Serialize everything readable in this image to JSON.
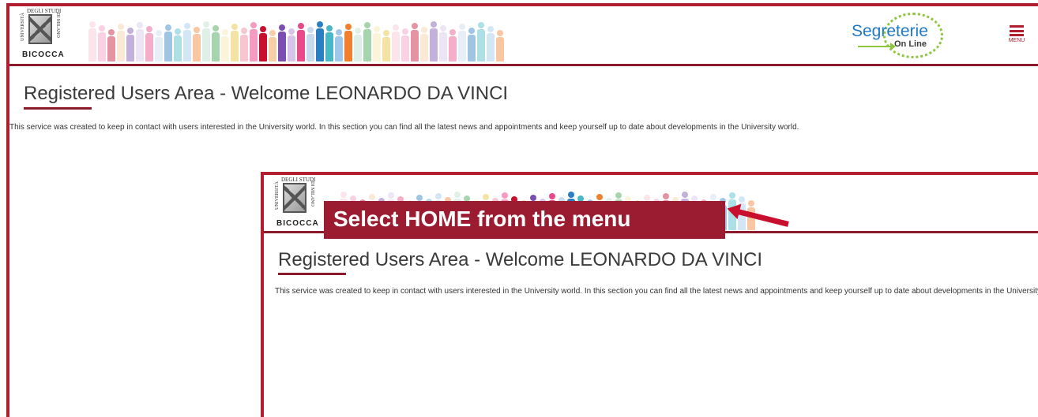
{
  "logo": {
    "top_text": "DEGLI STUDI",
    "left_text": "UNIVERSITÀ",
    "right_text": "DI MILANO",
    "bottom_text": "BICOCCA"
  },
  "header": {
    "service_logo_main": "Segreterie",
    "service_logo_sub": "On Line",
    "menu_label": "MENU"
  },
  "page": {
    "title": "Registered Users Area - Welcome LEONARDO DA VINCI",
    "description": "This service was created to keep in contact with users interested in the University world. In this section you can find all the latest news and appointments and keep yourself up to date about developments in the University world."
  },
  "inset": {
    "title": "Registered Users Area - Welcome LEONARDO DA VINCI",
    "description": "This service was created to keep in contact with users interested in the University world. In this section you can find all the latest news and appointments and keep yourself up to date about developments in the University world."
  },
  "callout": {
    "text": "Select HOME from the menu"
  },
  "colors": {
    "brand": "#b01e2f",
    "brand_dark": "#8c1a2b",
    "callout_bg": "#9b1b30",
    "sol_blue": "#2079c7",
    "sol_green": "#8dc63f"
  },
  "icons": {
    "menu": "hamburger-icon",
    "logo": "university-seal-icon",
    "arrow": "pointer-arrow-icon"
  }
}
